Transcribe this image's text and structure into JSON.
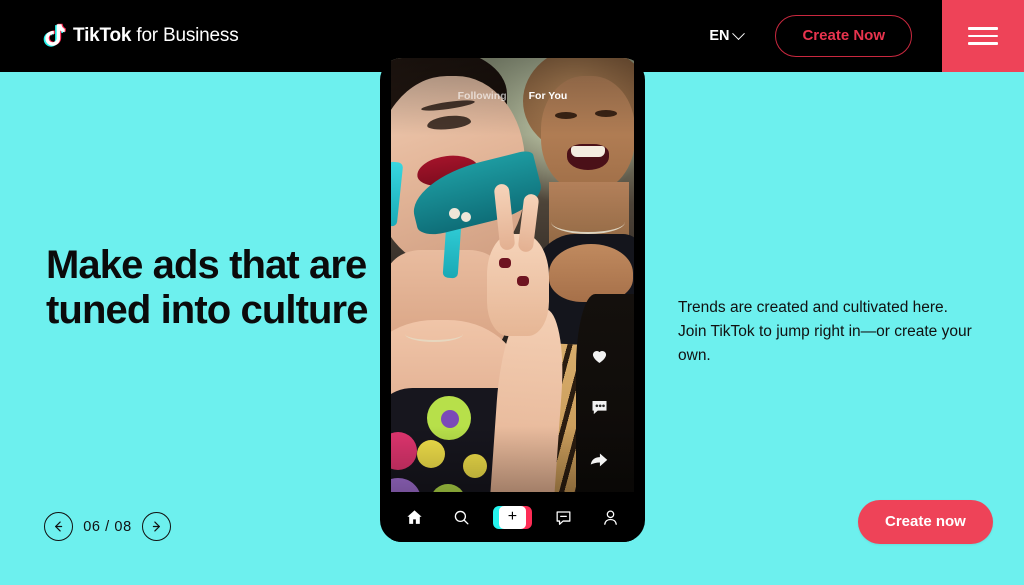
{
  "header": {
    "brand_bold": "TikTok",
    "brand_light": " for Business",
    "logo_icon": "tiktok-note-icon",
    "language": "EN",
    "language_chevron_icon": "chevron-down-icon",
    "create_now_label": "Create Now",
    "menu_icon": "hamburger-menu-icon",
    "bg_color": "#000000",
    "menu_bg_color": "#ee4358",
    "create_now_color": "#e8344e"
  },
  "hero": {
    "headline": "Make ads that are tuned into culture",
    "body": "Trends are created and cultivated here. Join TikTok to jump right in—or create your own.",
    "bg_color": "#6df0ee",
    "text_color": "#0b0b0b"
  },
  "carousel": {
    "prev_icon": "arrow-left-icon",
    "next_icon": "arrow-right-icon",
    "counter": "06 / 08",
    "current": "06",
    "total": "08"
  },
  "cta": {
    "label": "Create now",
    "bg_color": "#ee4358",
    "text_color": "#ffffff"
  },
  "phone": {
    "tabs": {
      "following": "Following",
      "for_you": "For You",
      "active": "For You"
    },
    "actions": [
      {
        "icon": "heart-icon",
        "name": "like-button"
      },
      {
        "icon": "comment-icon",
        "name": "comment-button"
      },
      {
        "icon": "share-icon",
        "name": "share-button"
      }
    ],
    "bottom_nav": [
      {
        "icon": "home-icon",
        "name": "nav-home"
      },
      {
        "icon": "search-icon",
        "name": "nav-discover"
      },
      {
        "icon": "plus-icon",
        "name": "nav-create"
      },
      {
        "icon": "inbox-icon",
        "name": "nav-inbox"
      },
      {
        "icon": "person-icon",
        "name": "nav-profile"
      }
    ],
    "create_symbol": "+"
  }
}
